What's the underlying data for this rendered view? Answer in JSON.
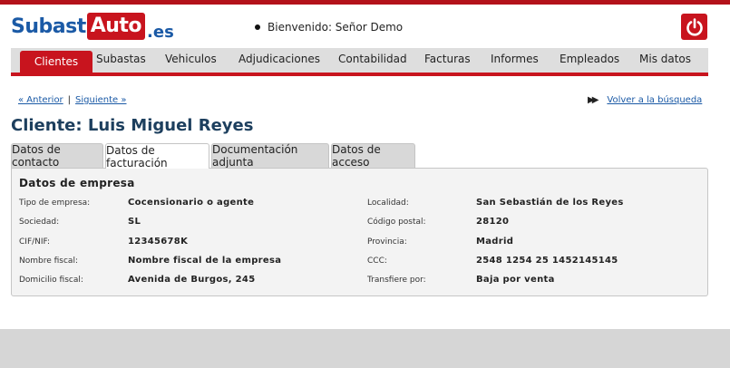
{
  "logo": {
    "part1": "Subast",
    "part2": "Auto",
    "part3": ".es"
  },
  "header": {
    "welcome": "Bienvenido: Señor Demo"
  },
  "nav": {
    "items": [
      "Clientes",
      "Subastas",
      "Vehiculos",
      "Adjudicaciones",
      "Contabilidad",
      "Facturas",
      "Informes",
      "Empleados",
      "Mis datos"
    ],
    "active": "Clientes"
  },
  "pager": {
    "prev": "« Anterior",
    "separator": "|",
    "next": "Siguiente »",
    "back": "Volver a la búsqueda"
  },
  "client": {
    "title": "Cliente: Luis Miguel Reyes"
  },
  "tabs": [
    "Datos de contacto",
    "Datos de facturación",
    "Documentación adjunta",
    "Datos de acceso"
  ],
  "active_tab": "Datos de facturación",
  "company": {
    "heading": "Datos de empresa",
    "left": [
      {
        "label": "Tipo de empresa:",
        "value": "Cocensionario o agente"
      },
      {
        "label": "Sociedad:",
        "value": "SL"
      },
      {
        "label": "CIF/NIF:",
        "value": "12345678K"
      },
      {
        "label": "Nombre fiscal:",
        "value": "Nombre fiscal de la empresa"
      },
      {
        "label": "Domicilio fiscal:",
        "value": "Avenida de Burgos, 245"
      }
    ],
    "right": [
      {
        "label": "Localidad:",
        "value": "San Sebastián de los Reyes"
      },
      {
        "label": "Código postal:",
        "value": "28120"
      },
      {
        "label": "Provincia:",
        "value": "Madrid"
      },
      {
        "label": "CCC:",
        "value": "2548 1254 25 1452145145"
      },
      {
        "label": "Transfiere por:",
        "value": "Baja por venta"
      }
    ]
  },
  "colors": {
    "brand_red": "#c8141e",
    "brand_blue": "#1b5aa6",
    "title_blue": "#1d3f5e"
  }
}
